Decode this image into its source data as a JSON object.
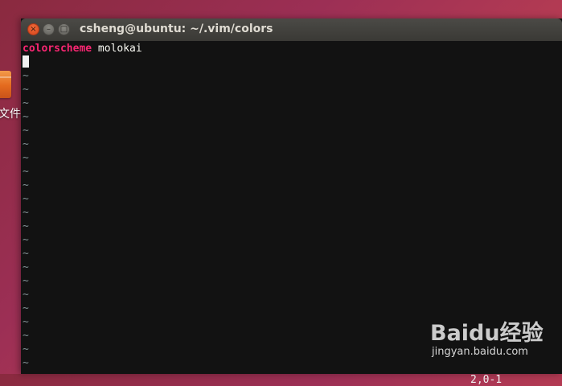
{
  "desktop": {
    "icon_label": "文件"
  },
  "window": {
    "title": "csheng@ubuntu: ~/.vim/colors",
    "buttons": {
      "close_glyph": "×",
      "minimize_glyph": "–",
      "maximize_glyph": "□"
    }
  },
  "editor": {
    "line1": {
      "keyword": "colorscheme",
      "argument": " molokai"
    },
    "empty_line_marker": "~",
    "empty_line_count": 22,
    "ruler": "2,0-1",
    "colors": {
      "background": "#121212",
      "keyword": "#f92672",
      "text": "#f8f8f2",
      "tilde": "#7e8e91"
    }
  },
  "watermark": {
    "logo": "Baidu经验",
    "url": "jingyan.baidu.com"
  }
}
